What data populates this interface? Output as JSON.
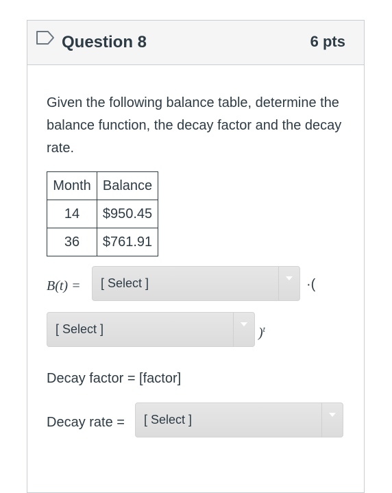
{
  "question": {
    "title": "Question 8",
    "points": "6 pts"
  },
  "prompt": "Given the following balance table, determine the balance function, the decay factor and the decay rate.",
  "table": {
    "headers": [
      "Month",
      "Balance"
    ],
    "rows": [
      [
        "14",
        "$950.45"
      ],
      [
        "36",
        "$761.91"
      ]
    ]
  },
  "formula": {
    "lhs": "B(t) =",
    "mult": "·(",
    "close": ")",
    "exponent": "t"
  },
  "select1": {
    "value": "[ Select ]"
  },
  "select2": {
    "value": "[ Select ]"
  },
  "decay_factor": {
    "label": "Decay factor = [factor]"
  },
  "decay_rate": {
    "label": "Decay rate =",
    "select_value": "[ Select ]"
  }
}
